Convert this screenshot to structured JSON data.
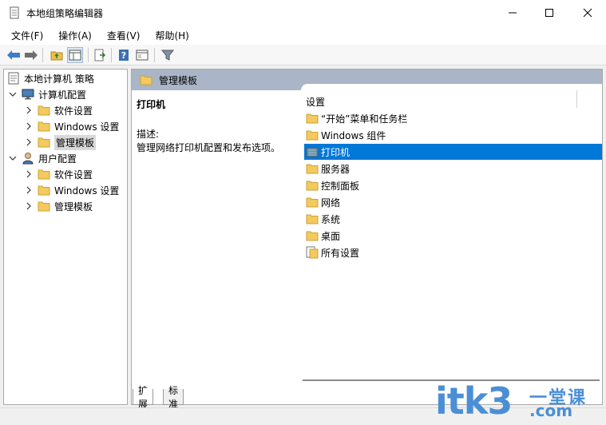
{
  "window": {
    "title": "本地组策略编辑器",
    "controls": {
      "minimize": "minimize-icon",
      "maximize": "maximize-icon",
      "close": "close-icon"
    }
  },
  "menu": [
    {
      "label": "文件(F)"
    },
    {
      "label": "操作(A)"
    },
    {
      "label": "查看(V)"
    },
    {
      "label": "帮助(H)"
    }
  ],
  "toolbar": {
    "icons": [
      "back-arrow-icon",
      "forward-arrow-icon",
      "up-folder-icon",
      "show-hide-tree-icon",
      "export-list-icon",
      "help-icon",
      "extended-view-icon",
      "filter-icon"
    ]
  },
  "tree": {
    "root": "本地计算机 策略",
    "computer_config": "计算机配置",
    "computer_children": [
      "软件设置",
      "Windows 设置",
      "管理模板"
    ],
    "user_config": "用户配置",
    "user_children": [
      "软件设置",
      "Windows 设置",
      "管理模板"
    ]
  },
  "right": {
    "header": "管理模板",
    "desc_title": "打印机",
    "desc_label": "描述:",
    "desc_text": "管理网络打印机配置和发布选项。",
    "list_header": "设置",
    "items": [
      {
        "label": "“开始”菜单和任务栏",
        "icon": "folder-icon"
      },
      {
        "label": "Windows 组件",
        "icon": "folder-icon"
      },
      {
        "label": "打印机",
        "icon": "printer-folder-icon",
        "selected": true
      },
      {
        "label": "服务器",
        "icon": "folder-icon"
      },
      {
        "label": "控制面板",
        "icon": "folder-icon"
      },
      {
        "label": "网络",
        "icon": "folder-icon"
      },
      {
        "label": "系统",
        "icon": "folder-icon"
      },
      {
        "label": "桌面",
        "icon": "folder-icon"
      },
      {
        "label": "所有设置",
        "icon": "all-settings-icon"
      }
    ]
  },
  "tabs": [
    {
      "label": "扩展",
      "active": true
    },
    {
      "label": "标准",
      "active": false
    }
  ],
  "watermark": {
    "brand": "itk3",
    "cn": "一堂课",
    "domain": ".com"
  },
  "colors": {
    "selection": "#0078d7",
    "header_bar": "#aab6c7",
    "folder": "#f4c95d",
    "watermark": "#4a8fd6"
  }
}
